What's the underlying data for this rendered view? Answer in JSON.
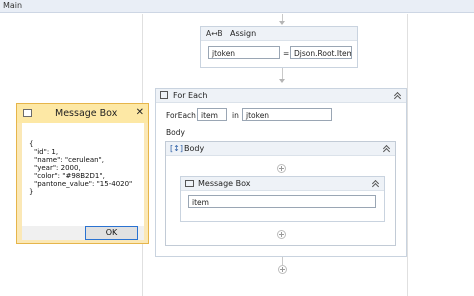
{
  "tab": {
    "label": "Main"
  },
  "assign": {
    "title": "Assign",
    "to_value": "jtoken",
    "operator": "=",
    "expression_value": "Djson.Root.Item(\"c"
  },
  "foreach": {
    "title": "For Each",
    "foreach_label": "ForEach",
    "item_value": "item",
    "in_label": "in",
    "collection_value": "jtoken",
    "body_label": "Body"
  },
  "body_sequence": {
    "title": "Body"
  },
  "message_box_activity": {
    "title": "Message Box",
    "text_value": "item"
  },
  "dialog": {
    "title": "Message Box",
    "close_symbol": "✕",
    "json_lines": [
      "{",
      "\"id\": 1,",
      "\"name\": \"cerulean\",",
      "\"year\": 2000,",
      "\"color\": \"#98B2D1\",",
      "\"pantone_value\": \"15-4020\"",
      "}"
    ],
    "ok_label": "OK"
  },
  "colors": {
    "dialog_border": "#e6b54a",
    "dialog_title_bg": "#fde8a5",
    "ok_focus": "#2a72d1"
  }
}
